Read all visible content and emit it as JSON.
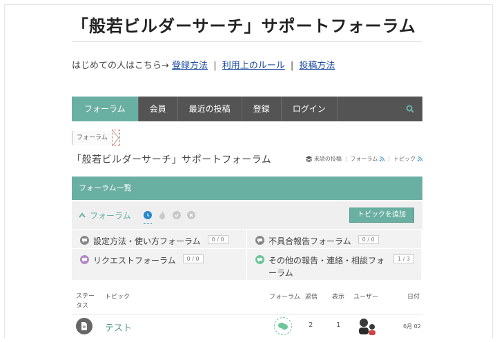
{
  "site": {
    "title": "「般若ビルダーサーチ」サポートフォーラム"
  },
  "intro": {
    "text": "はじめての人はこちら→",
    "links": [
      "登録方法",
      "利用上のルール",
      "投稿方法"
    ],
    "separator": "|"
  },
  "nav": {
    "items": [
      "フォーラム",
      "会員",
      "最近の投稿",
      "登録",
      "ログイン"
    ],
    "active_index": 0,
    "search_icon": "search-icon"
  },
  "breadcrumb": {
    "items": [
      "フォーラム"
    ]
  },
  "page": {
    "title": "「般若ビルダーサーチ」サポートフォーラム",
    "feeds": [
      "未読の投稿",
      "フォーラム",
      "トピック"
    ],
    "feed_separator": "|"
  },
  "forum_list": {
    "header": "フォーラム一覧",
    "toolbar_label": "フォーラム",
    "add_topic_label": "トピックを追加",
    "filter_icons": [
      "clock-icon",
      "fire-icon",
      "check-icon",
      "close-icon"
    ],
    "forums": [
      {
        "label": "設定方法・使い方フォーラム",
        "count": "0 / 0",
        "color": "#888888"
      },
      {
        "label": "不具合報告フォーラム",
        "count": "0 / 0",
        "color": "#888888"
      },
      {
        "label": "リクエストフォーラム",
        "count": "0 / 0",
        "color": "#b48ac8"
      },
      {
        "label": "その他の報告・連絡・相談フォーラム",
        "count": "1 / 3",
        "color": "#6cc69a"
      }
    ]
  },
  "topic_table": {
    "columns": {
      "status": "ステータス",
      "topic": "トピック",
      "forum": "フォーラム",
      "replies": "返信",
      "views": "表示",
      "users": "ユーザー",
      "date": "日付"
    },
    "rows": [
      {
        "title": "テスト",
        "replies": "2",
        "views": "1",
        "date": "6月 02"
      }
    ]
  },
  "colors": {
    "accent": "#6ab0a2",
    "nav_bg": "#545454",
    "link": "#1a4aa0"
  }
}
